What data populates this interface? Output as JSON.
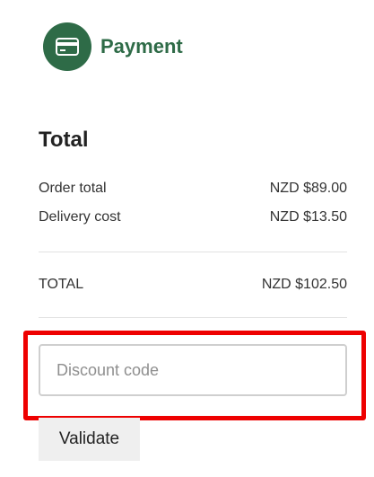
{
  "colors": {
    "accent": "#2e6b47",
    "highlight_border": "#ee0000",
    "button_bg": "#efefef"
  },
  "header": {
    "icon": "credit-card-icon",
    "title": "Payment"
  },
  "summary": {
    "title": "Total",
    "lines": [
      {
        "label": "Order total",
        "value": "NZD $89.00"
      },
      {
        "label": "Delivery cost",
        "value": "NZD $13.50"
      }
    ],
    "total": {
      "label": "TOTAL",
      "value": "NZD $102.50"
    }
  },
  "discount": {
    "placeholder": "Discount code",
    "value": "",
    "button_label": "Validate"
  }
}
